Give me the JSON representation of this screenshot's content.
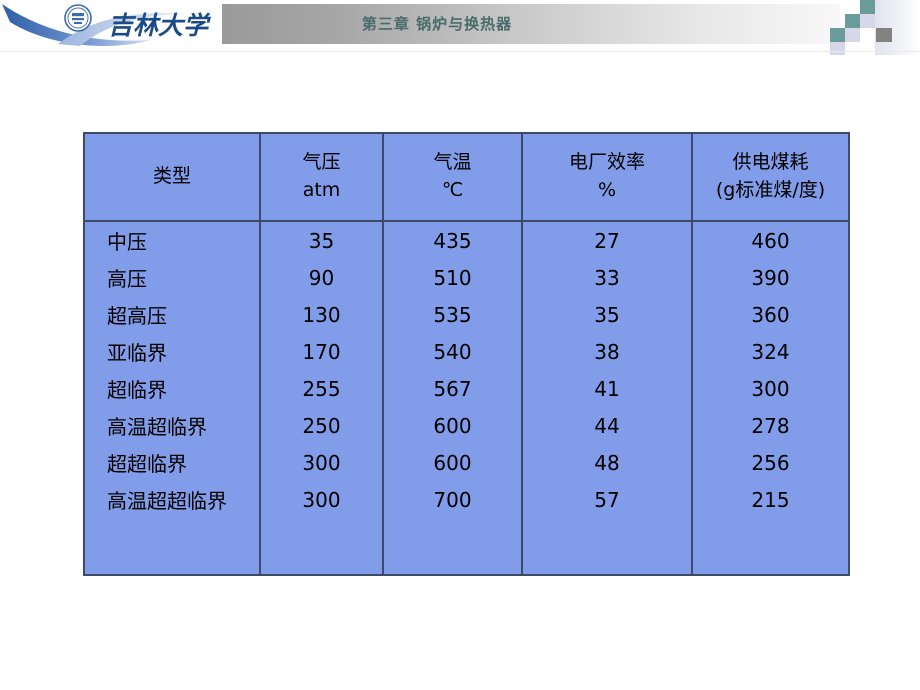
{
  "header": {
    "title": "第三章  锅炉与换热器",
    "logo_text": "吉林大学",
    "logo_seal_name": "jilin-university-seal",
    "accent_teal": "#6a9c9c",
    "accent_lavender": "#d6d8ea",
    "accent_grey": "#828282",
    "title_color": "#4a6b6b",
    "swoosh_color": "#5b7fc4"
  },
  "table": {
    "bg_color": "#819ce8",
    "border_color": "#3f4a6b",
    "headers": [
      {
        "line1": "类型",
        "line2": ""
      },
      {
        "line1": "气压",
        "line2": "atm"
      },
      {
        "line1": "气温",
        "line2": "℃"
      },
      {
        "line1": "电厂效率",
        "line2": "%"
      },
      {
        "line1": "供电煤耗",
        "line2": "(g标准煤/度)"
      }
    ],
    "rows": [
      {
        "type": "中压",
        "pressure": "35",
        "temperature": "435",
        "efficiency": "27",
        "coal": "460"
      },
      {
        "type": "高压",
        "pressure": "90",
        "temperature": "510",
        "efficiency": "33",
        "coal": "390"
      },
      {
        "type": "超高压",
        "pressure": "130",
        "temperature": "535",
        "efficiency": "35",
        "coal": "360"
      },
      {
        "type": "亚临界",
        "pressure": "170",
        "temperature": "540",
        "efficiency": "38",
        "coal": "324"
      },
      {
        "type": "超临界",
        "pressure": "255",
        "temperature": "567",
        "efficiency": "41",
        "coal": "300"
      },
      {
        "type": "高温超临界",
        "pressure": "250",
        "temperature": "600",
        "efficiency": "44",
        "coal": "278"
      },
      {
        "type": "超超临界",
        "pressure": "300",
        "temperature": "600",
        "efficiency": "48",
        "coal": "256"
      },
      {
        "type": "高温超超临界",
        "pressure": "300",
        "temperature": "700",
        "efficiency": "57",
        "coal": "215"
      }
    ]
  },
  "chart_data": {
    "type": "table",
    "title": "第三章  锅炉与换热器",
    "columns": [
      "类型",
      "气压 atm",
      "气温 ℃",
      "电厂效率 %",
      "供电煤耗 (g标准煤/度)"
    ],
    "rows": [
      [
        "中压",
        35,
        435,
        27,
        460
      ],
      [
        "高压",
        90,
        510,
        33,
        390
      ],
      [
        "超高压",
        130,
        535,
        35,
        360
      ],
      [
        "亚临界",
        170,
        540,
        38,
        324
      ],
      [
        "超临界",
        255,
        567,
        41,
        300
      ],
      [
        "高温超临界",
        250,
        600,
        44,
        278
      ],
      [
        "超超临界",
        300,
        600,
        48,
        256
      ],
      [
        "高温超超临界",
        300,
        700,
        57,
        215
      ]
    ]
  }
}
